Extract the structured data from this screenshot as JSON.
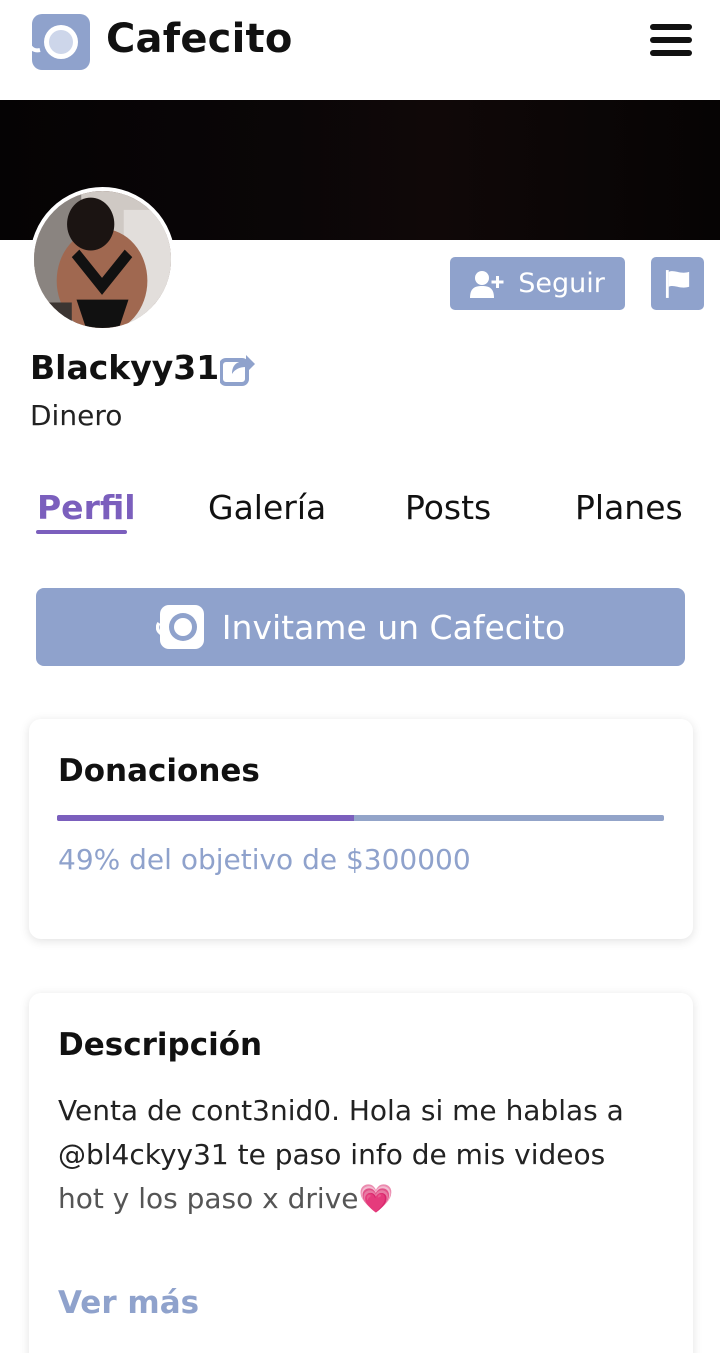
{
  "header": {
    "brand": "Cafecito"
  },
  "profile": {
    "username": "Blackyy31",
    "subtitle": "Dinero",
    "follow_label": "Seguir"
  },
  "tabs": [
    {
      "label": "Perfil",
      "active": true
    },
    {
      "label": "Galería",
      "active": false
    },
    {
      "label": "Posts",
      "active": false
    },
    {
      "label": "Planes",
      "active": false
    }
  ],
  "invite": {
    "label": "Invitame un Cafecito"
  },
  "donations": {
    "title": "Donaciones",
    "progress_percent": 49,
    "goal_text": "49% del objetivo de $300000"
  },
  "description": {
    "title": "Descripción",
    "line1": "Venta de cont3nid0. Hola si me hablas a",
    "line2": "@bl4ckyy31 te paso info de mis videos",
    "line3": "hot y los paso x drive",
    "emoji": "💗",
    "see_more": "Ver más"
  },
  "colors": {
    "accent": "#7b5fbd",
    "button": "#8fa2cc",
    "cover": "#0a0607"
  },
  "icons": [
    "cafecito-logo-icon",
    "hamburger-menu-icon",
    "user-plus-icon",
    "flag-icon",
    "share-icon",
    "cafecito-cup-icon"
  ]
}
